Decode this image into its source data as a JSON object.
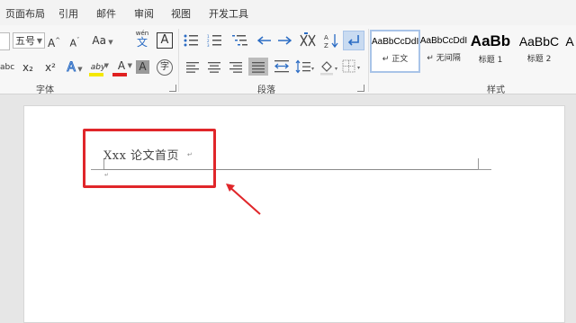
{
  "tabs": [
    "页面布局",
    "引用",
    "邮件",
    "审阅",
    "视图",
    "开发工具"
  ],
  "font": {
    "size_value": "五号",
    "group_label": "字体",
    "grow_label": "A",
    "shrink_label": "A",
    "case_label": "Aa",
    "pinyin_top": "wén",
    "pinyin_bottom": "文",
    "border_char_label": "A",
    "abc_label": "abc",
    "subscript_label": "x₂",
    "superscript_label": "x²",
    "text_effect_label": "A",
    "highlight_label": "aby",
    "font_color_label": "A",
    "char_shading_label": "A",
    "enclose_label": "字"
  },
  "paragraph": {
    "group_label": "段落"
  },
  "styles": {
    "group_label": "样式",
    "items": [
      {
        "sample": "AaBbCcDdI",
        "name": "↵ 正文",
        "selected": true
      },
      {
        "sample": "AaBbCcDdI",
        "name": "↵ 无间隔",
        "selected": false
      },
      {
        "sample": "AaBb",
        "name": "标题 1",
        "selected": false
      },
      {
        "sample": "AaBbC",
        "name": "标题 2",
        "selected": false
      },
      {
        "sample": "A",
        "name": "",
        "selected": false
      }
    ]
  },
  "document": {
    "header_text": "Xxx 论文首页",
    "highlight_color": "#e0262a"
  },
  "colors": {
    "highlight_yellow": "#f4e800",
    "font_red": "#e02020",
    "accent_blue": "#2b6cc4"
  }
}
